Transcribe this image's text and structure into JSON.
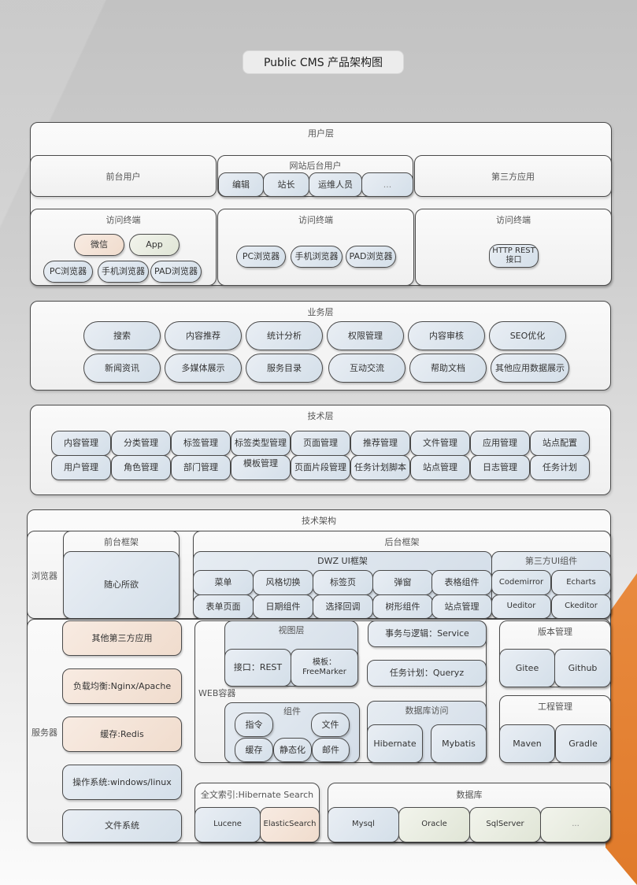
{
  "title": "Public CMS 产品架构图",
  "user_layer": {
    "label": "用户层",
    "frontend_users": "前台用户",
    "backend_users": {
      "label": "网站后台用户",
      "roles": [
        "编辑",
        "站长",
        "运维人员",
        "..."
      ]
    },
    "third_party": "第三方应用",
    "terminals": [
      {
        "label": "访问终端",
        "items_top": [
          "微信",
          "App"
        ],
        "items_bottom": [
          "PC浏览器",
          "手机浏览器",
          "PAD浏览器"
        ]
      },
      {
        "label": "访问终端",
        "items": [
          "PC浏览器",
          "手机浏览器",
          "PAD浏览器"
        ]
      },
      {
        "label": "访问终端",
        "items": [
          "HTTP REST\n接口"
        ]
      }
    ]
  },
  "business_layer": {
    "label": "业务层",
    "row1": [
      "搜索",
      "内容推荐",
      "统计分析",
      "权限管理",
      "内容审核",
      "SEO优化"
    ],
    "row2": [
      "新闻资讯",
      "多媒体展示",
      "服务目录",
      "互动交流",
      "帮助文档",
      "其他应用数据展示"
    ]
  },
  "tech_layer": {
    "label": "技术层",
    "row1": [
      "内容管理",
      "分类管理",
      "标签管理",
      "标签类型管理",
      "页面管理",
      "推荐管理",
      "文件管理",
      "应用管理",
      "站点配置"
    ],
    "row2": [
      "用户管理",
      "角色管理",
      "部门管理",
      "模板管理",
      "页面片段管理",
      "任务计划脚本",
      "站点管理",
      "日志管理",
      "任务计划"
    ]
  },
  "architecture": {
    "label": "技术架构",
    "browser": {
      "label": "浏览器",
      "frontend_framework": {
        "label": "前台框架",
        "content": "随心所欲"
      },
      "backend_framework": {
        "label": "后台框架",
        "dwz": {
          "label": "DWZ UI框架",
          "row1": [
            "菜单",
            "风格切换",
            "标签页",
            "弹窗",
            "表格组件"
          ],
          "row2": [
            "表单页面",
            "日期组件",
            "选择回调",
            "树形组件",
            "站点管理"
          ]
        },
        "third_ui": {
          "label": "第三方UI组件",
          "row1": [
            "Codemirror",
            "Echarts"
          ],
          "row2": [
            "Ueditor",
            "Ckeditor"
          ]
        }
      }
    },
    "server": {
      "label": "服务器",
      "left_stack": [
        "其他第三方应用",
        "负载均衡:Nginx/Apache",
        "缓存:Redis",
        "操作系统:windows/linux",
        "文件系统"
      ],
      "web_container": {
        "label": "WEB容器",
        "view_layer": {
          "label": "视图层",
          "items": [
            "接口：REST",
            "模板：\nFreeMarker"
          ]
        },
        "components": {
          "label": "组件",
          "items": [
            "指令",
            "文件",
            "缓存",
            "静态化",
            "邮件"
          ]
        },
        "service": "事务与逻辑：Service",
        "scheduler": "任务计划：Queryz",
        "db_access": {
          "label": "数据库访问",
          "items": [
            "Hibernate",
            "Mybatis"
          ]
        }
      },
      "version_control": {
        "label": "版本管理",
        "items": [
          "Gitee",
          "Github"
        ]
      },
      "build": {
        "label": "工程管理",
        "items": [
          "Maven",
          "Gradle"
        ]
      },
      "fulltext": {
        "label": "全文索引:Hibernate Search",
        "items": [
          "Lucene",
          "ElasticSearch"
        ]
      },
      "database": {
        "label": "数据库",
        "items": [
          "Mysql",
          "Oracle",
          "SqlServer",
          "..."
        ]
      }
    }
  }
}
